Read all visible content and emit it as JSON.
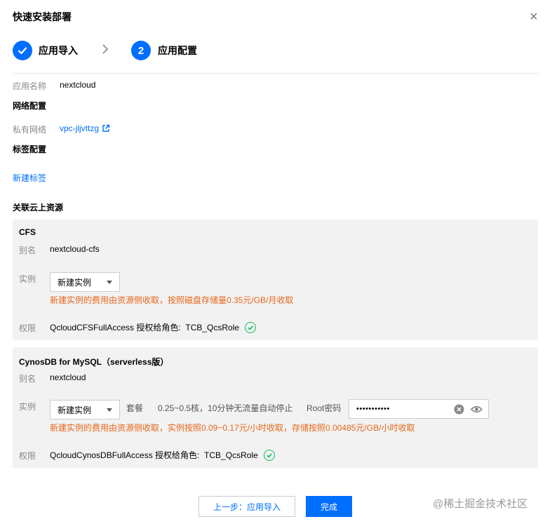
{
  "dialog": {
    "title": "快速安装部署",
    "close_symbol": "×"
  },
  "steps": [
    {
      "label": "应用导入",
      "state": "done"
    },
    {
      "label": "应用配置",
      "number": "2",
      "state": "active"
    }
  ],
  "step_separator": "›",
  "app": {
    "name_label": "应用名称",
    "name_value": "nextcloud"
  },
  "network": {
    "section_title": "网络配置",
    "vpc_label": "私有网络",
    "vpc_value": "vpc-jljvttzg"
  },
  "tags": {
    "section_title": "标签配置",
    "new_tag_link": "新建标签"
  },
  "resources": {
    "section_title": "关联云上资源",
    "cfs": {
      "title": "CFS",
      "alias_label": "别名",
      "alias_value": "nextcloud-cfs",
      "instance_label": "实例",
      "instance_select": "新建实例",
      "fee_note": "新建实例的费用由资源侧收取，按照磁盘存储量0.35元/GB/月收取",
      "perm_label": "权限",
      "perm_value": "QcloudCFSFullAccess 授权给角色:  TCB_QcsRole"
    },
    "cynosdb": {
      "title": "CynosDB for MySQL（serverless版）",
      "alias_label": "别名",
      "alias_value": "nextcloud",
      "instance_label": "实例",
      "instance_select": "新建实例",
      "plan_label": "套餐",
      "plan_value": "0.25~0.5核，10分钟无流量自动停止",
      "root_pwd_label": "Root密码",
      "root_pwd_value": "•••••••••••",
      "fee_note": "新建实例的费用由资源侧收取，实例按照0.09~0.17元/小时收取，存储按照0.00485元/GB/小时收取",
      "perm_label": "权限",
      "perm_value": "QcloudCynosDBFullAccess 授权给角色:  TCB_QcsRole"
    }
  },
  "footer": {
    "prev_button": "上一步：应用导入",
    "done_button": "完成"
  },
  "watermark": "@稀土掘金技术社区",
  "colors": {
    "accent": "#006eff",
    "warning": "#e8661b",
    "success": "#0abf5b",
    "panel_bg": "#f2f2f2"
  }
}
